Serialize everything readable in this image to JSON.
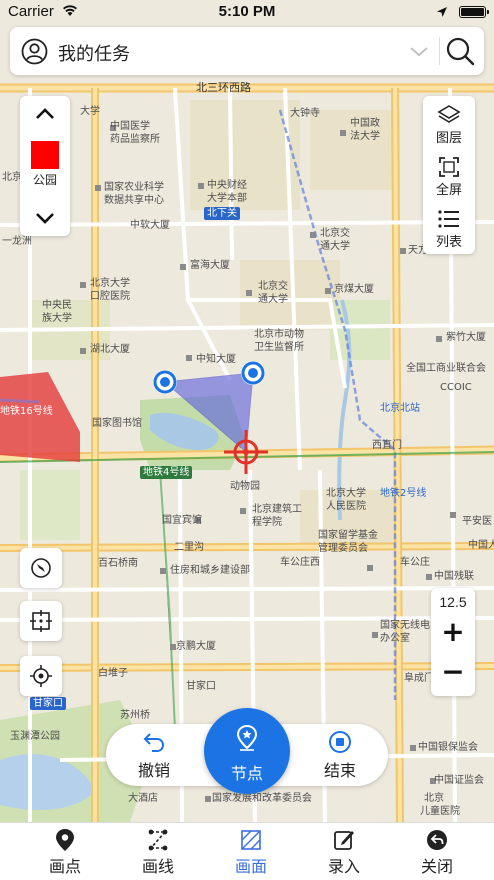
{
  "status_bar": {
    "carrier": "Carrier",
    "time": "5:10 PM"
  },
  "search_bar": {
    "title": "我的任务"
  },
  "layer_card": {
    "label": "公园",
    "swatch_color": "#ff0000"
  },
  "tool_card": {
    "layers": "图层",
    "fullscreen": "全屏",
    "list": "列表"
  },
  "zoom": {
    "level": "12.5",
    "plus": "+",
    "minus": "−"
  },
  "actions": {
    "undo": "撤销",
    "node": "节点",
    "end": "结束"
  },
  "tabs": [
    {
      "label": "画点"
    },
    {
      "label": "画线"
    },
    {
      "label": "画面"
    },
    {
      "label": "录入"
    },
    {
      "label": "关闭"
    }
  ],
  "colors": {
    "accent": "#1c74e4",
    "polygon_fill": "#5b5ee0",
    "active_tab": "#3b6fe0"
  },
  "map_labels": {
    "l1": "北三环西路",
    "l2": "大学",
    "l3": "中国医学",
    "l4": "药品监察所",
    "l5": "大钟寺",
    "l6": "中国政",
    "l7": "法大学",
    "l8": "北京",
    "l9": "国家农业科学",
    "l10": "数据共享中心",
    "l11": "中央财经",
    "l12": "大学本部",
    "l13": "北下关",
    "l14": "中软大厦",
    "l15": "北京交",
    "l16": "通大学",
    "l17": "天方",
    "l18": "富海大厦",
    "l19": "北京大学",
    "l20": "口腔医院",
    "l21": "北京交",
    "l22": "通大学",
    "l23": "京煤大厦",
    "l24": "中央民",
    "l25": "族大学",
    "l26": "湖北大厦",
    "l27": "北京市动物",
    "l28": "卫生监督所",
    "l29": "紫竹大厦",
    "l30": "中知大厦",
    "l31": "全国工商业联合会",
    "l32": "国家图书馆",
    "l33": "北京北站",
    "l34": "西直门",
    "l35": "地铁4号线",
    "l36": "动物园",
    "l37": "北京大学",
    "l38": "人民医院",
    "l39": "北京建筑工",
    "l40": "程学院",
    "l41": "国宜宾馆",
    "l42": "国家留学基金",
    "l43": "管理委员会",
    "l44": "平安医",
    "l45": "中国人",
    "l46": "二里沟",
    "l47": "车公庄西",
    "l48": "车公庄",
    "l49": "百石桥南",
    "l50": "住房和城乡建设部",
    "l51": "中国残联",
    "l52": "京鹏大厦",
    "l53": "国家无线电",
    "l54": "办公室",
    "l55": "白堆子",
    "l56": "甘家口",
    "l57": "阜成门",
    "l58": "甘家口",
    "l59": "玉渊潭公园",
    "l60": "中国银保监会",
    "l61": "中国证监会",
    "l62": "国家发展和改革委员会",
    "l63": "大酒店",
    "l64": "地铁16号线",
    "l65": "地铁2号线",
    "l66": "北京",
    "l67": "儿童医院",
    "l68": "CCOIC",
    "l69": "一龙洲",
    "l70": "苏州桥"
  }
}
